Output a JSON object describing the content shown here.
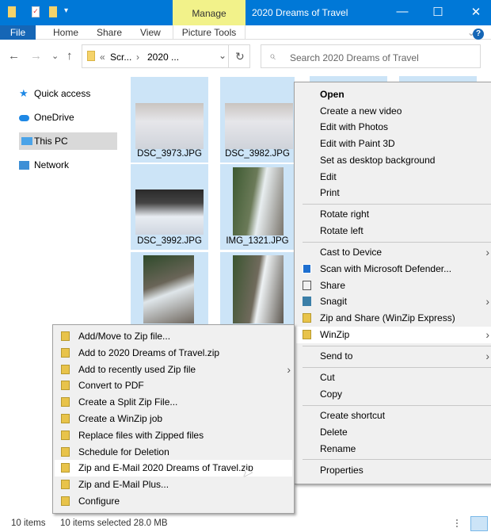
{
  "window": {
    "title": "2020 Dreams of Travel",
    "context_tab": "Manage",
    "minimize": "—",
    "maximize": "☐",
    "close": "✕"
  },
  "ribbon": {
    "tabs": [
      "File",
      "Home",
      "Share",
      "View"
    ],
    "picture_tools": "Picture Tools",
    "help": "?"
  },
  "address": {
    "crumbs": [
      "«",
      "Scr...",
      "›",
      "2020 ..."
    ],
    "refresh": "↻",
    "dropdown": "⌄"
  },
  "search": {
    "placeholder": "Search 2020 Dreams of Travel",
    "icon": "⌕"
  },
  "nav": {
    "back": "←",
    "forward": "→",
    "recent": "⌄",
    "up": "↑"
  },
  "sidebar": {
    "items": [
      {
        "label": "Quick access",
        "icon": "star-icon"
      },
      {
        "label": "OneDrive",
        "icon": "cloud-icon"
      },
      {
        "label": "This PC",
        "icon": "monitor-icon",
        "selected": true
      },
      {
        "label": "Network",
        "icon": "network-icon"
      }
    ]
  },
  "files": [
    {
      "name": "DSC_3973.JPG"
    },
    {
      "name": "DSC_3982.JPG"
    },
    {
      "name": "DSC_3992.JPG"
    },
    {
      "name": "IMG_1321.JPG"
    },
    {
      "name": ""
    },
    {
      "name": ""
    }
  ],
  "context_menu": {
    "items": [
      {
        "label": "Open",
        "bold": true
      },
      {
        "label": "Create a new video"
      },
      {
        "label": "Edit with Photos"
      },
      {
        "label": "Edit with Paint 3D"
      },
      {
        "label": "Set as desktop background"
      },
      {
        "label": "Edit"
      },
      {
        "label": "Print"
      },
      {
        "sep": true
      },
      {
        "label": "Rotate right"
      },
      {
        "label": "Rotate left"
      },
      {
        "sep": true
      },
      {
        "label": "Cast to Device",
        "submenu": true
      },
      {
        "label": "Scan with Microsoft Defender...",
        "icon": "defender-icon"
      },
      {
        "label": "Share",
        "icon": "share-icon"
      },
      {
        "label": "Snagit",
        "icon": "snagit-icon",
        "submenu": true
      },
      {
        "label": "Zip and Share (WinZip Express)",
        "icon": "winzip-icon"
      },
      {
        "label": "WinZip",
        "icon": "winzip-icon",
        "submenu": true,
        "highlighted": true
      },
      {
        "sep": true
      },
      {
        "label": "Send to",
        "submenu": true
      },
      {
        "sep": true
      },
      {
        "label": "Cut"
      },
      {
        "label": "Copy"
      },
      {
        "sep": true
      },
      {
        "label": "Create shortcut"
      },
      {
        "label": "Delete"
      },
      {
        "label": "Rename"
      },
      {
        "sep": true
      },
      {
        "label": "Properties"
      }
    ]
  },
  "winzip_menu": {
    "items": [
      {
        "label": "Add/Move to Zip file..."
      },
      {
        "label": "Add to 2020 Dreams of Travel.zip"
      },
      {
        "label": "Add to recently used Zip file",
        "submenu": true
      },
      {
        "label": "Convert to PDF"
      },
      {
        "label": "Create a Split Zip File..."
      },
      {
        "label": "Create a WinZip job"
      },
      {
        "label": "Replace files with Zipped files"
      },
      {
        "label": "Schedule for Deletion"
      },
      {
        "label": "Zip and E-Mail 2020 Dreams of Travel.zip",
        "highlighted": true
      },
      {
        "label": "Zip and E-Mail Plus..."
      },
      {
        "label": "Configure"
      }
    ]
  },
  "status": {
    "count": "10 items",
    "selected": "10 items selected  28.0 MB"
  },
  "colors": {
    "accent": "#0078d7",
    "manage": "#f2f28a",
    "selection": "#cce4f7",
    "menu": "#f0f0f0"
  }
}
